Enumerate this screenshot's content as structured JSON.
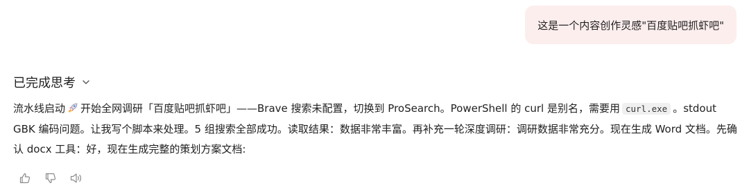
{
  "user_message": {
    "text": "这是一个内容创作灵感\"百度贴吧抓虾吧\""
  },
  "assistant": {
    "thinking_title": "已完成思考",
    "segments": {
      "s1": "流水线启动",
      "s2": "开始全网调研「百度贴吧抓虾吧」——Brave 搜索未配置，切换到 ProSearch。PowerShell 的 curl 是别名，需要用",
      "code": "curl.exe",
      "s3": "。stdout GBK 编码问题。让我写个脚本来处理。5 组搜索全部成功。读取结果：数据非常丰富。再补充一轮深度调研：调研数据非常充分。现在生成 Word 文档。先确认 docx 工具：好，现在生成完整的策划方案文档:"
    },
    "icons": {
      "rocket": "rocket-icon",
      "chevron": "chevron-down-icon"
    },
    "actions": [
      {
        "name": "thumbs-up-icon"
      },
      {
        "name": "thumbs-down-icon"
      },
      {
        "name": "speaker-icon"
      }
    ]
  },
  "colors": {
    "user_bubble_bg": "#fdeeee",
    "text": "#1f1f1f",
    "icon": "#8a8a8a"
  }
}
